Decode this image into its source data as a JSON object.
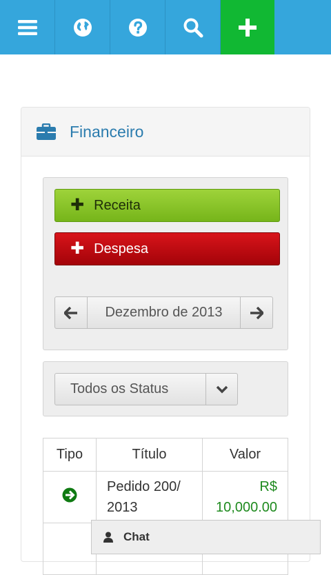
{
  "topbar": {
    "buttons": [
      {
        "icon": "menu-icon"
      },
      {
        "icon": "globe-icon"
      },
      {
        "icon": "help-icon"
      },
      {
        "icon": "search-icon"
      },
      {
        "icon": "plus-icon"
      }
    ],
    "colors": {
      "bar": "#35a6dc",
      "add": "#11b833"
    }
  },
  "panel": {
    "icon": "briefcase-icon",
    "title": "Financeiro"
  },
  "actions": {
    "receita_label": "Receita",
    "despesa_label": "Despesa",
    "receita_color": "#8cc82a",
    "despesa_color": "#c20a10"
  },
  "month_nav": {
    "label": "Dezembro de 2013"
  },
  "status_filter": {
    "selected": "Todos os Status"
  },
  "table": {
    "headers": [
      "Tipo",
      "Título",
      "Valor"
    ],
    "rows": [
      {
        "tipo_icon": "arrow-circle-right-icon",
        "titulo_line1": "Pedido 200/",
        "titulo_line2": "2013",
        "valor_line1": "R$",
        "valor_line2": "10,000.00"
      }
    ]
  },
  "chat": {
    "icon": "user-icon",
    "label": "Chat"
  }
}
